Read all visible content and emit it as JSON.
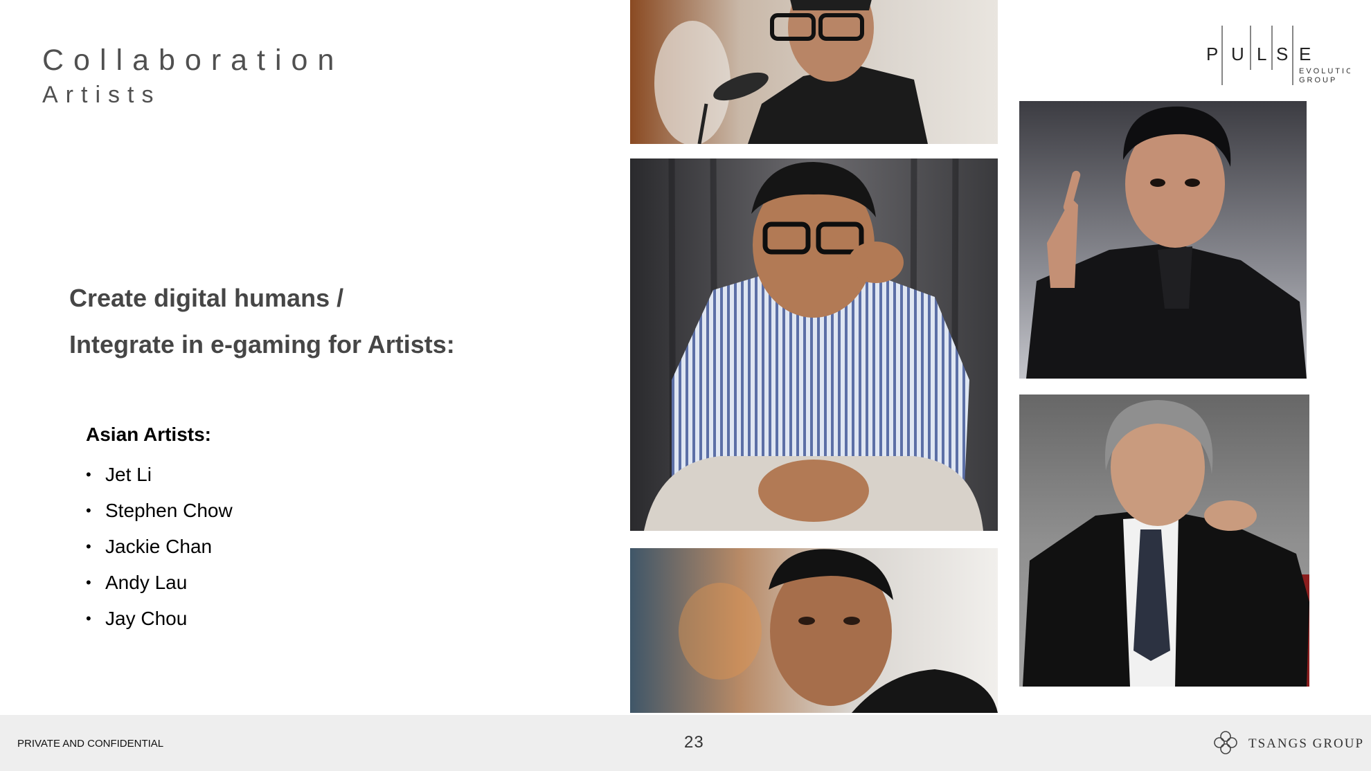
{
  "slide": {
    "title": "Collaboration",
    "subtitle": "Artists",
    "heading_line1": "Create digital humans /",
    "heading_line2": "Integrate in e-gaming for Artists:",
    "section_label": "Asian Artists:",
    "bullet_glyph": "•",
    "artists": [
      "Jet Li",
      "Stephen Chow",
      "Jackie Chan",
      "Andy Lau",
      "Jay Chou"
    ]
  },
  "logo": {
    "letters": [
      "P",
      "U",
      "L",
      "S",
      "E"
    ],
    "line1": "EVOLUTION",
    "line2": "GROUP"
  },
  "photos": [
    {
      "name": "photo-jet-li"
    },
    {
      "name": "photo-jackie-chan"
    },
    {
      "name": "photo-andy-lau"
    },
    {
      "name": "photo-jay-chou"
    },
    {
      "name": "photo-stephen-chow"
    }
  ],
  "footer": {
    "confidential": "PRIVATE AND CONFIDENTIAL",
    "page_number": "23",
    "company": "TSANGS GROUP",
    "icon": "tsangs-logo-icon"
  }
}
